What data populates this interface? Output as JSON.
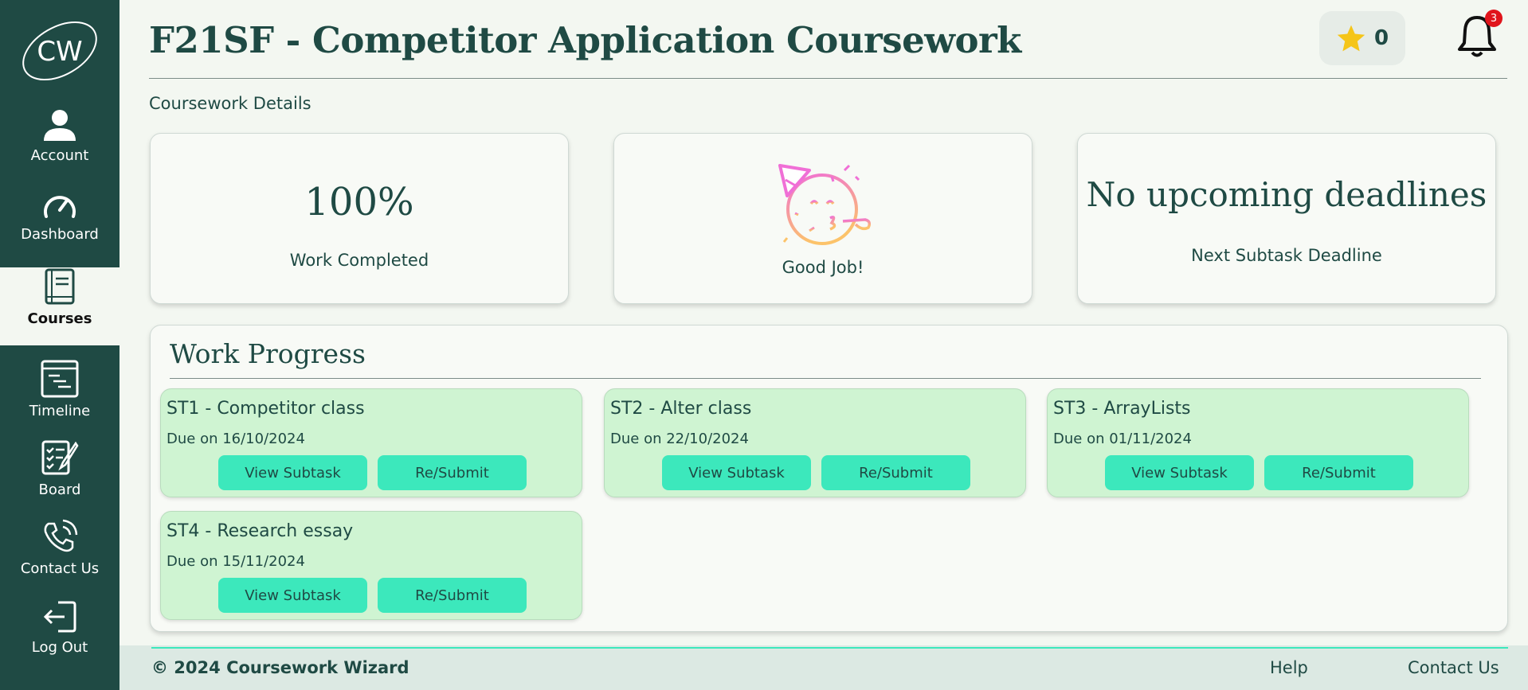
{
  "app": {
    "logo_text": "CW"
  },
  "sidebar": {
    "items": [
      {
        "label": "Account",
        "icon": "user-icon"
      },
      {
        "label": "Dashboard",
        "icon": "speedometer-icon"
      },
      {
        "label": "Courses",
        "icon": "book-icon",
        "active": true
      },
      {
        "label": "Timeline",
        "icon": "timeline-icon"
      },
      {
        "label": "Board",
        "icon": "checklist-icon"
      },
      {
        "label": "Contact Us",
        "icon": "phone-icon"
      },
      {
        "label": "Log Out",
        "icon": "logout-icon"
      }
    ]
  },
  "header": {
    "title": "F21SF - Competitor Application Coursework",
    "stars": "0",
    "notifications": "3"
  },
  "details": {
    "section_label": "Coursework Details",
    "completion_value": "100%",
    "completion_label": "Work Completed",
    "celebration_label": "Good Job!",
    "deadline_value": "No upcoming deadlines",
    "deadline_label": "Next Subtask Deadline"
  },
  "progress": {
    "title": "Work Progress",
    "view_label": "View Subtask",
    "submit_label": "Re/Submit",
    "subtasks": [
      {
        "name": "ST1 - Competitor class",
        "due": "Due on 16/10/2024"
      },
      {
        "name": "ST2 - Alter class",
        "due": "Due on 22/10/2024"
      },
      {
        "name": "ST3 - ArrayLists",
        "due": "Due on 01/11/2024"
      },
      {
        "name": "ST4 - Research essay",
        "due": "Due on 15/11/2024"
      }
    ]
  },
  "footer": {
    "copyright": "© 2024 Coursework Wizard",
    "help": "Help",
    "contact": "Contact Us"
  },
  "colors": {
    "sidebar": "#1f4a44",
    "accent": "#3ce8bc",
    "subtask_bg": "#cff4d2",
    "badge": "#e0141b"
  }
}
